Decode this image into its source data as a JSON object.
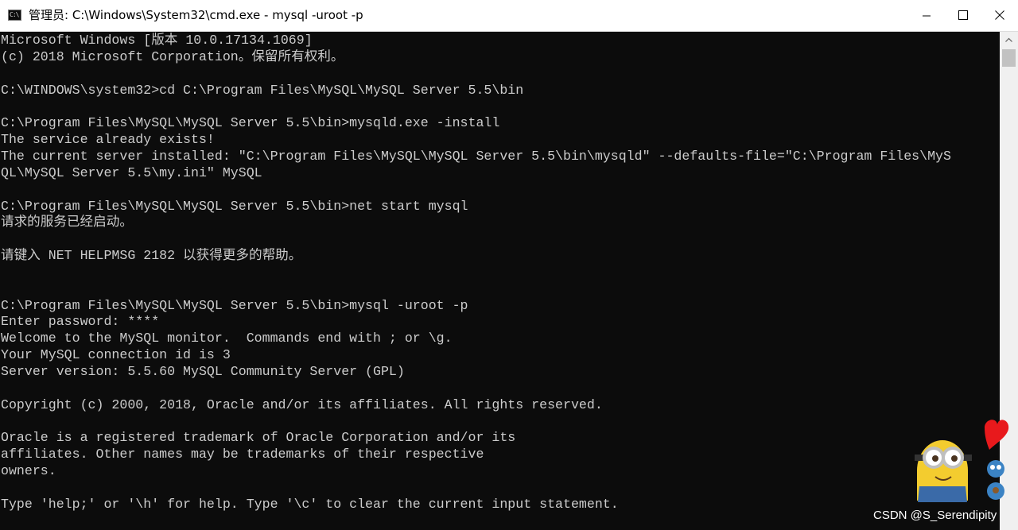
{
  "window": {
    "title": "管理员: C:\\Windows\\System32\\cmd.exe - mysql  -uroot -p",
    "icon": "cmd-icon",
    "icon_glyph": "C:\\"
  },
  "controls": {
    "minimize": "minimize-icon",
    "maximize": "maximize-icon",
    "close": "close-icon"
  },
  "console": {
    "lines": [
      "Microsoft Windows [版本 10.0.17134.1069]",
      "(c) 2018 Microsoft Corporation。保留所有权利。",
      "",
      "C:\\WINDOWS\\system32>cd C:\\Program Files\\MySQL\\MySQL Server 5.5\\bin",
      "",
      "C:\\Program Files\\MySQL\\MySQL Server 5.5\\bin>mysqld.exe -install",
      "The service already exists!",
      "The current server installed: \"C:\\Program Files\\MySQL\\MySQL Server 5.5\\bin\\mysqld\" --defaults-file=\"C:\\Program Files\\MyS",
      "QL\\MySQL Server 5.5\\my.ini\" MySQL",
      "",
      "C:\\Program Files\\MySQL\\MySQL Server 5.5\\bin>net start mysql",
      "请求的服务已经启动。",
      "",
      "请键入 NET HELPMSG 2182 以获得更多的帮助。",
      "",
      "",
      "C:\\Program Files\\MySQL\\MySQL Server 5.5\\bin>mysql -uroot -p",
      "Enter password: ****",
      "Welcome to the MySQL monitor.  Commands end with ; or \\g.",
      "Your MySQL connection id is 3",
      "Server version: 5.5.60 MySQL Community Server (GPL)",
      "",
      "Copyright (c) 2000, 2018, Oracle and/or its affiliates. All rights reserved.",
      "",
      "Oracle is a registered trademark of Oracle Corporation and/or its",
      "affiliates. Other names may be trademarks of their respective",
      "owners.",
      "",
      "Type 'help;' or '\\h' for help. Type '\\c' to clear the current input statement."
    ]
  },
  "watermark": {
    "text": "CSDN @S_Serendipity"
  },
  "sticker": {
    "icon": "minion-heart-sticker-icon"
  },
  "colors": {
    "console_bg": "#0c0c0c",
    "console_fg": "#cccccc",
    "titlebar_bg": "#ffffff",
    "heart": "#e8191c"
  }
}
